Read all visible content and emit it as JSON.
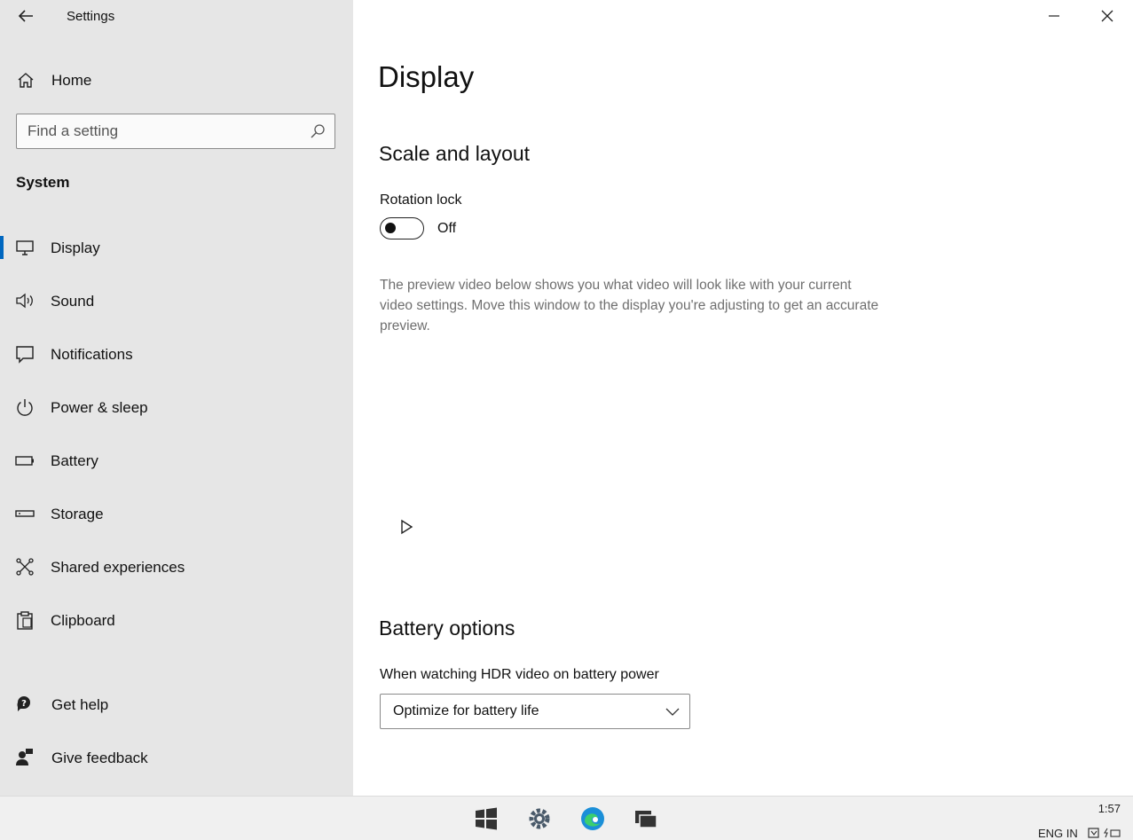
{
  "window": {
    "title": "Settings"
  },
  "sidebar": {
    "home_label": "Home",
    "search_placeholder": "Find a setting",
    "section": "System",
    "items": [
      {
        "label": "Display",
        "icon": "monitor-icon",
        "active": true
      },
      {
        "label": "Sound",
        "icon": "speaker-icon"
      },
      {
        "label": "Notifications",
        "icon": "notification-icon"
      },
      {
        "label": "Power & sleep",
        "icon": "power-icon"
      },
      {
        "label": "Battery",
        "icon": "battery-icon"
      },
      {
        "label": "Storage",
        "icon": "storage-icon"
      },
      {
        "label": "Shared experiences",
        "icon": "shared-experiences-icon"
      },
      {
        "label": "Clipboard",
        "icon": "clipboard-icon"
      }
    ],
    "footer": [
      {
        "label": "Get help",
        "icon": "help-icon"
      },
      {
        "label": "Give feedback",
        "icon": "feedback-icon"
      }
    ]
  },
  "main": {
    "title": "Display",
    "scale_section": "Scale and layout",
    "rotation_lock_label": "Rotation lock",
    "rotation_lock_state": "Off",
    "preview_description": "The preview video below shows you what video will look like with your current video settings. Move this window to the display you're adjusting to get an accurate preview.",
    "battery_section": "Battery options",
    "hdr_label": "When watching HDR video on battery power",
    "hdr_value": "Optimize for battery life"
  },
  "taskbar": {
    "time": "1:57",
    "language": "ENG IN",
    "icons": [
      "windows-start-icon",
      "settings-gear-icon",
      "edge-browser-icon",
      "task-view-icon"
    ]
  },
  "colors": {
    "accent": "#0067c0",
    "sidebar_bg": "#e6e6e6",
    "taskbar_bg": "#f0f0f0"
  }
}
